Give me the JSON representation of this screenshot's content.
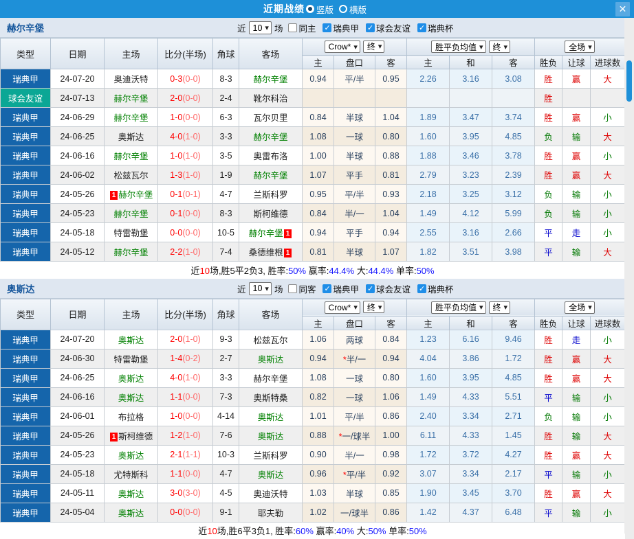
{
  "title_bar": {
    "title": "近期战绩",
    "radios": [
      {
        "label": "竖版",
        "selected": true
      },
      {
        "label": "横版",
        "selected": false
      }
    ],
    "close_label": "✕"
  },
  "badge_label": "1",
  "star_label": "*",
  "table_header": {
    "cols": [
      "类型",
      "日期",
      "主场",
      "比分(半场)",
      "角球",
      "客场"
    ],
    "sub": [
      "主",
      "盘口",
      "客",
      "主",
      "和",
      "客",
      "胜负",
      "让球",
      "进球数"
    ],
    "selects": {
      "book": "Crow*",
      "final1": "终",
      "avg": "胜平负均值",
      "final2": "终",
      "scope": "全场"
    }
  },
  "colors": {
    "titlebar_blue": "#1e90d8",
    "league_blue": "#1565ab",
    "friendly_teal": "#0ba795",
    "win_red": "#dd0000",
    "draw_blue": "#0000cc",
    "lose_green": "#007700",
    "score_red": "#ff0000",
    "avg_blue": "#3a70a8"
  },
  "sections": [
    {
      "team": "赫尔辛堡",
      "filter": {
        "prefix": "近",
        "count": "10",
        "suffix": "场",
        "same_label": "同主",
        "same_checked": false,
        "leagues": [
          {
            "label": "瑞典甲",
            "checked": true
          },
          {
            "label": "球会友谊",
            "checked": true
          },
          {
            "label": "瑞典杯",
            "checked": true
          }
        ]
      },
      "rows": [
        {
          "lg": "瑞典甲",
          "lgt": "league",
          "date": "24-07-20",
          "h": {
            "n": "奥迪沃特"
          },
          "score": "0-3",
          "half": "(0-0)",
          "corner": "8-3",
          "a": {
            "n": "赫尔辛堡",
            "g": true
          },
          "o1": "0.94",
          "pk": "平/半",
          "o2": "0.95",
          "m1": "2.26",
          "m2": "3.16",
          "m3": "3.08",
          "r1": "胜",
          "r2": "赢",
          "r3": "大"
        },
        {
          "lg": "球会友谊",
          "lgt": "friendly",
          "date": "24-07-13",
          "h": {
            "n": "赫尔辛堡",
            "g": true
          },
          "score": "2-0",
          "half": "(0-0)",
          "corner": "2-4",
          "a": {
            "n": "靴尔科治"
          },
          "o1": "",
          "pk": "",
          "o2": "",
          "m1": "",
          "m2": "",
          "m3": "",
          "r1": "胜",
          "r2": "",
          "r3": ""
        },
        {
          "lg": "瑞典甲",
          "lgt": "league",
          "date": "24-06-29",
          "h": {
            "n": "赫尔辛堡",
            "g": true
          },
          "score": "1-0",
          "half": "(0-0)",
          "corner": "6-3",
          "a": {
            "n": "瓦尔贝里"
          },
          "o1": "0.84",
          "pk": "半球",
          "o2": "1.04",
          "m1": "1.89",
          "m2": "3.47",
          "m3": "3.74",
          "r1": "胜",
          "r2": "赢",
          "r3": "小"
        },
        {
          "lg": "瑞典甲",
          "lgt": "league",
          "date": "24-06-25",
          "h": {
            "n": "奥斯达"
          },
          "score": "4-0",
          "half": "(1-0)",
          "corner": "3-3",
          "a": {
            "n": "赫尔辛堡",
            "g": true
          },
          "o1": "1.08",
          "pk": "一球",
          "o2": "0.80",
          "m1": "1.60",
          "m2": "3.95",
          "m3": "4.85",
          "r1": "负",
          "r2": "输",
          "r3": "大"
        },
        {
          "lg": "瑞典甲",
          "lgt": "league",
          "date": "24-06-16",
          "h": {
            "n": "赫尔辛堡",
            "g": true
          },
          "score": "1-0",
          "half": "(1-0)",
          "corner": "3-5",
          "a": {
            "n": "奥雷布洛"
          },
          "o1": "1.00",
          "pk": "半球",
          "o2": "0.88",
          "m1": "1.88",
          "m2": "3.46",
          "m3": "3.78",
          "r1": "胜",
          "r2": "赢",
          "r3": "小"
        },
        {
          "lg": "瑞典甲",
          "lgt": "league",
          "date": "24-06-02",
          "h": {
            "n": "松兹瓦尔"
          },
          "score": "1-3",
          "half": "(1-0)",
          "corner": "1-9",
          "a": {
            "n": "赫尔辛堡",
            "g": true
          },
          "o1": "1.07",
          "pk": "平手",
          "o2": "0.81",
          "m1": "2.79",
          "m2": "3.23",
          "m3": "2.39",
          "r1": "胜",
          "r2": "赢",
          "r3": "大"
        },
        {
          "lg": "瑞典甲",
          "lgt": "league",
          "date": "24-05-26",
          "h": {
            "n": "赫尔辛堡",
            "g": true,
            "b": "pre"
          },
          "score": "0-1",
          "half": "(0-1)",
          "corner": "4-7",
          "a": {
            "n": "兰斯科罗"
          },
          "o1": "0.95",
          "pk": "平/半",
          "o2": "0.93",
          "m1": "2.18",
          "m2": "3.25",
          "m3": "3.12",
          "r1": "负",
          "r2": "输",
          "r3": "小"
        },
        {
          "lg": "瑞典甲",
          "lgt": "league",
          "date": "24-05-23",
          "h": {
            "n": "赫尔辛堡",
            "g": true
          },
          "score": "0-1",
          "half": "(0-0)",
          "corner": "8-3",
          "a": {
            "n": "斯柯维德"
          },
          "o1": "0.84",
          "pk": "半/一",
          "o2": "1.04",
          "m1": "1.49",
          "m2": "4.12",
          "m3": "5.99",
          "r1": "负",
          "r2": "输",
          "r3": "小"
        },
        {
          "lg": "瑞典甲",
          "lgt": "league",
          "date": "24-05-18",
          "h": {
            "n": "特雷勒堡"
          },
          "score": "0-0",
          "half": "(0-0)",
          "corner": "10-5",
          "a": {
            "n": "赫尔辛堡",
            "g": true,
            "b": "post"
          },
          "o1": "0.94",
          "pk": "平手",
          "o2": "0.94",
          "m1": "2.55",
          "m2": "3.16",
          "m3": "2.66",
          "r1": "平",
          "r2": "走",
          "r3": "小"
        },
        {
          "lg": "瑞典甲",
          "lgt": "league",
          "date": "24-05-12",
          "h": {
            "n": "赫尔辛堡",
            "g": true
          },
          "score": "2-2",
          "half": "(1-0)",
          "corner": "7-4",
          "a": {
            "n": "桑德维根",
            "b": "post"
          },
          "o1": "0.81",
          "pk": "半球",
          "o2": "1.07",
          "m1": "1.82",
          "m2": "3.51",
          "m3": "3.98",
          "r1": "平",
          "r2": "输",
          "r3": "大"
        }
      ],
      "summary": [
        [
          "近",
          "k"
        ],
        [
          "10",
          "r"
        ],
        [
          "场,胜5平2负3, 胜率:",
          "k"
        ],
        [
          "50%",
          "b"
        ],
        [
          " 赢率:",
          "k"
        ],
        [
          "44.4%",
          "b"
        ],
        [
          " 大:",
          "k"
        ],
        [
          "44.4%",
          "b"
        ],
        [
          " 单率:",
          "k"
        ],
        [
          "50%",
          "b"
        ]
      ]
    },
    {
      "team": "奥斯达",
      "filter": {
        "prefix": "近",
        "count": "10",
        "suffix": "场",
        "same_label": "同客",
        "same_checked": false,
        "leagues": [
          {
            "label": "瑞典甲",
            "checked": true
          },
          {
            "label": "球会友谊",
            "checked": true
          },
          {
            "label": "瑞典杯",
            "checked": true
          }
        ]
      },
      "rows": [
        {
          "lg": "瑞典甲",
          "lgt": "league",
          "date": "24-07-20",
          "h": {
            "n": "奥斯达",
            "g": true
          },
          "score": "2-0",
          "half": "(1-0)",
          "corner": "9-3",
          "a": {
            "n": "松兹瓦尔"
          },
          "o1": "1.06",
          "pk": "两球",
          "o2": "0.84",
          "m1": "1.23",
          "m2": "6.16",
          "m3": "9.46",
          "r1": "胜",
          "r2": "走",
          "r3": "小"
        },
        {
          "lg": "瑞典甲",
          "lgt": "league",
          "date": "24-06-30",
          "h": {
            "n": "特雷勒堡"
          },
          "score": "1-4",
          "half": "(0-2)",
          "corner": "2-7",
          "a": {
            "n": "奥斯达",
            "g": true
          },
          "o1": "0.94",
          "pk": "半/一",
          "pks": true,
          "o2": "0.94",
          "m1": "4.04",
          "m2": "3.86",
          "m3": "1.72",
          "r1": "胜",
          "r2": "赢",
          "r3": "大"
        },
        {
          "lg": "瑞典甲",
          "lgt": "league",
          "date": "24-06-25",
          "h": {
            "n": "奥斯达",
            "g": true
          },
          "score": "4-0",
          "half": "(1-0)",
          "corner": "3-3",
          "a": {
            "n": "赫尔辛堡"
          },
          "o1": "1.08",
          "pk": "一球",
          "o2": "0.80",
          "m1": "1.60",
          "m2": "3.95",
          "m3": "4.85",
          "r1": "胜",
          "r2": "赢",
          "r3": "大"
        },
        {
          "lg": "瑞典甲",
          "lgt": "league",
          "date": "24-06-16",
          "h": {
            "n": "奥斯达",
            "g": true
          },
          "score": "1-1",
          "half": "(0-0)",
          "corner": "7-3",
          "a": {
            "n": "奥斯特桑"
          },
          "o1": "0.82",
          "pk": "一球",
          "o2": "1.06",
          "m1": "1.49",
          "m2": "4.33",
          "m3": "5.51",
          "r1": "平",
          "r2": "输",
          "r3": "小"
        },
        {
          "lg": "瑞典甲",
          "lgt": "league",
          "date": "24-06-01",
          "h": {
            "n": "布拉格"
          },
          "score": "1-0",
          "half": "(0-0)",
          "corner": "4-14",
          "a": {
            "n": "奥斯达",
            "g": true
          },
          "o1": "1.01",
          "pk": "平/半",
          "o2": "0.86",
          "m1": "2.40",
          "m2": "3.34",
          "m3": "2.71",
          "r1": "负",
          "r2": "输",
          "r3": "小"
        },
        {
          "lg": "瑞典甲",
          "lgt": "league",
          "date": "24-05-26",
          "h": {
            "n": "斯柯维德",
            "b": "pre"
          },
          "score": "1-2",
          "half": "(1-0)",
          "corner": "7-6",
          "a": {
            "n": "奥斯达",
            "g": true
          },
          "o1": "0.88",
          "pk": "一/球半",
          "pks": true,
          "o2": "1.00",
          "m1": "6.11",
          "m2": "4.33",
          "m3": "1.45",
          "r1": "胜",
          "r2": "输",
          "r3": "大"
        },
        {
          "lg": "瑞典甲",
          "lgt": "league",
          "date": "24-05-23",
          "h": {
            "n": "奥斯达",
            "g": true
          },
          "score": "2-1",
          "half": "(1-1)",
          "corner": "10-3",
          "a": {
            "n": "兰斯科罗"
          },
          "o1": "0.90",
          "pk": "半/一",
          "o2": "0.98",
          "m1": "1.72",
          "m2": "3.72",
          "m3": "4.27",
          "r1": "胜",
          "r2": "赢",
          "r3": "大"
        },
        {
          "lg": "瑞典甲",
          "lgt": "league",
          "date": "24-05-18",
          "h": {
            "n": "尤特斯科"
          },
          "score": "1-1",
          "half": "(0-0)",
          "corner": "4-7",
          "a": {
            "n": "奥斯达",
            "g": true
          },
          "o1": "0.96",
          "pk": "平/半",
          "pks": true,
          "o2": "0.92",
          "m1": "3.07",
          "m2": "3.34",
          "m3": "2.17",
          "r1": "平",
          "r2": "输",
          "r3": "小"
        },
        {
          "lg": "瑞典甲",
          "lgt": "league",
          "date": "24-05-11",
          "h": {
            "n": "奥斯达",
            "g": true
          },
          "score": "3-0",
          "half": "(3-0)",
          "corner": "4-5",
          "a": {
            "n": "奥迪沃特"
          },
          "o1": "1.03",
          "pk": "半球",
          "o2": "0.85",
          "m1": "1.90",
          "m2": "3.45",
          "m3": "3.70",
          "r1": "胜",
          "r2": "赢",
          "r3": "大"
        },
        {
          "lg": "瑞典甲",
          "lgt": "league",
          "date": "24-05-04",
          "h": {
            "n": "奥斯达",
            "g": true
          },
          "score": "0-0",
          "half": "(0-0)",
          "corner": "9-1",
          "a": {
            "n": "耶夫勒"
          },
          "o1": "1.02",
          "pk": "一/球半",
          "o2": "0.86",
          "m1": "1.42",
          "m2": "4.37",
          "m3": "6.48",
          "r1": "平",
          "r2": "输",
          "r3": "小"
        }
      ],
      "summary": [
        [
          "近",
          "k"
        ],
        [
          "10",
          "r"
        ],
        [
          "场,胜6平3负1, 胜率:",
          "k"
        ],
        [
          "60%",
          "b"
        ],
        [
          " 赢率:",
          "k"
        ],
        [
          "40%",
          "b"
        ],
        [
          " 大:",
          "k"
        ],
        [
          "50%",
          "b"
        ],
        [
          " 单率:",
          "k"
        ],
        [
          "50%",
          "b"
        ]
      ]
    }
  ]
}
